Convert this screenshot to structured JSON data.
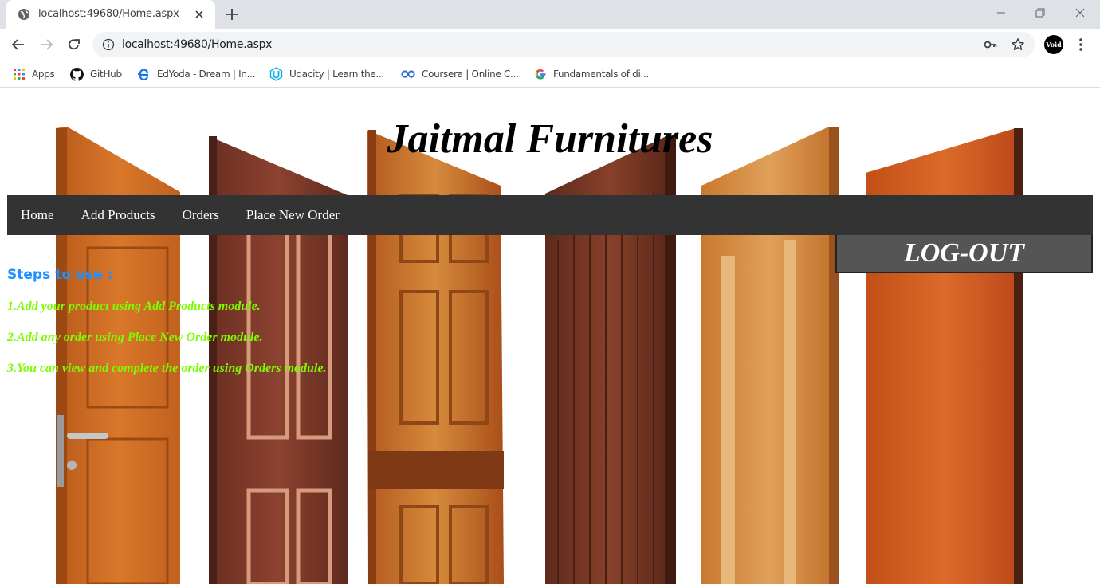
{
  "browser": {
    "tab_title": "localhost:49680/Home.aspx",
    "url": "localhost:49680/Home.aspx",
    "profile_label": "Void",
    "bookmarks": [
      {
        "label": "Apps",
        "icon": "apps-grid-icon"
      },
      {
        "label": "GitHub",
        "icon": "github-icon"
      },
      {
        "label": "EdYoda - Dream | In...",
        "icon": "edyoda-icon"
      },
      {
        "label": "Udacity | Learn the...",
        "icon": "udacity-icon"
      },
      {
        "label": "Coursera | Online C...",
        "icon": "coursera-icon"
      },
      {
        "label": "Fundamentals of di...",
        "icon": "google-icon"
      }
    ]
  },
  "site": {
    "title": "Jaitmal Furnitures",
    "nav": [
      "Home",
      "Add Products",
      "Orders",
      "Place New Order"
    ],
    "logout_label": "LOG-OUT",
    "steps_heading": "Steps to use :",
    "steps": [
      "1.Add your product using Add Products module.",
      "2.Add any order using Place New Order module.",
      "3.You can view and complete the order using Orders module."
    ]
  },
  "colors": {
    "navbar": "#333333",
    "logout_bg": "#555555",
    "steps_heading": "#1e90ff",
    "steps_text": "#7cfc00"
  }
}
